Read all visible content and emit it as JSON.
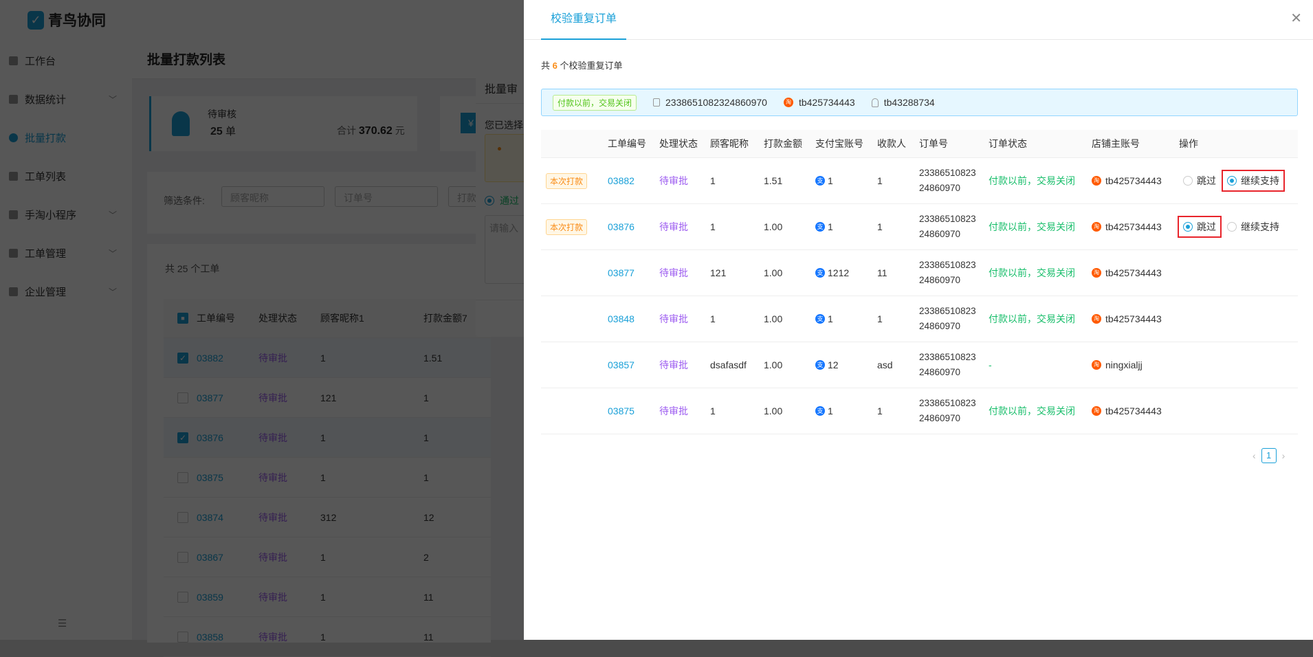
{
  "app": {
    "name": "青鸟协同"
  },
  "sidebar": {
    "items": [
      {
        "label": "工作台",
        "chevron": false
      },
      {
        "label": "数据统计",
        "chevron": true
      },
      {
        "label": "批量打款",
        "chevron": false,
        "active": true
      },
      {
        "label": "工单列表",
        "chevron": false
      },
      {
        "label": "手淘小程序",
        "chevron": true
      },
      {
        "label": "工单管理",
        "chevron": true
      },
      {
        "label": "企业管理",
        "chevron": true
      }
    ],
    "collapse_icon": "☰"
  },
  "page": {
    "title": "批量打款列表",
    "card": {
      "label": "待审核",
      "count": "25",
      "count_unit": "单",
      "total_label": "合计",
      "total": "370.62",
      "total_unit": "元"
    },
    "filter": {
      "label": "筛选条件:",
      "placeholders": [
        "顾客昵称",
        "订单号",
        "打款"
      ]
    },
    "total_text": "共 25 个工单",
    "table": {
      "headers": [
        "工单编号",
        "处理状态",
        "顾客昵称1",
        "打款金额7"
      ],
      "rows": [
        {
          "checked": true,
          "id": "03882",
          "status": "待审批",
          "nick": "1",
          "amount": "1.51"
        },
        {
          "checked": false,
          "id": "03877",
          "status": "待审批",
          "nick": "121",
          "amount": "1"
        },
        {
          "checked": true,
          "id": "03876",
          "status": "待审批",
          "nick": "1",
          "amount": "1"
        },
        {
          "checked": false,
          "id": "03875",
          "status": "待审批",
          "nick": "1",
          "amount": "1"
        },
        {
          "checked": false,
          "id": "03874",
          "status": "待审批",
          "nick": "312",
          "amount": "12"
        },
        {
          "checked": false,
          "id": "03867",
          "status": "待审批",
          "nick": "1",
          "amount": "2"
        },
        {
          "checked": false,
          "id": "03859",
          "status": "待审批",
          "nick": "1",
          "amount": "11"
        },
        {
          "checked": false,
          "id": "03858",
          "status": "待审批",
          "nick": "1",
          "amount": "11"
        }
      ]
    }
  },
  "bg_modal": {
    "title": "批量审",
    "selected_text": "您已选择",
    "radio_label": "通过",
    "textarea_placeholder": "请输入"
  },
  "drawer": {
    "tab": "校验重复订单",
    "close": "✕",
    "count_prefix": "共",
    "count": "6",
    "count_suffix": "个校验重复订单",
    "alert": {
      "status_tag": "付款以前，交易关闭",
      "order_no": "2338651082324860970",
      "shop": "tb425734443",
      "buyer": "tb43288734"
    },
    "headers": [
      "",
      "工单编号",
      "处理状态",
      "顾客昵称",
      "打款金额",
      "支付宝账号",
      "收款人",
      "订单号",
      "订单状态",
      "店铺主账号",
      "操作"
    ],
    "rows": [
      {
        "tag": "本次打款",
        "id": "03882",
        "status": "待审批",
        "nick": "1",
        "amount": "1.51",
        "alipay": "1",
        "payee": "1",
        "order": "2338651082324860970",
        "order_status": "付款以前，交易关闭",
        "shop": "tb425734443",
        "options": [
          "跳过",
          "继续支持"
        ],
        "selected": 1
      },
      {
        "tag": "本次打款",
        "id": "03876",
        "status": "待审批",
        "nick": "1",
        "amount": "1.00",
        "alipay": "1",
        "payee": "1",
        "order": "2338651082324860970",
        "order_status": "付款以前，交易关闭",
        "shop": "tb425734443",
        "options": [
          "跳过",
          "继续支持"
        ],
        "selected": 0
      },
      {
        "tag": "",
        "id": "03877",
        "status": "待审批",
        "nick": "121",
        "amount": "1.00",
        "alipay": "1212",
        "payee": "11",
        "order": "2338651082324860970",
        "order_status": "付款以前，交易关闭",
        "shop": "tb425734443"
      },
      {
        "tag": "",
        "id": "03848",
        "status": "待审批",
        "nick": "1",
        "amount": "1.00",
        "alipay": "1",
        "payee": "1",
        "order": "2338651082324860970",
        "order_status": "付款以前，交易关闭",
        "shop": "tb425734443"
      },
      {
        "tag": "",
        "id": "03857",
        "status": "待审批",
        "nick": "dsafasdf",
        "amount": "1.00",
        "alipay": "12",
        "payee": "asd",
        "order": "2338651082324860970",
        "order_status": "-",
        "shop": "ningxialjj"
      },
      {
        "tag": "",
        "id": "03875",
        "status": "待审批",
        "nick": "1",
        "amount": "1.00",
        "alipay": "1",
        "payee": "1",
        "order": "2338651082324860970",
        "order_status": "付款以前，交易关闭",
        "shop": "tb425734443"
      }
    ],
    "pagination": {
      "current": "1",
      "prev": "‹",
      "next": "›"
    }
  },
  "colors": {
    "accent": "#1aa0d8",
    "pending": "#9c5bf0",
    "closed": "#19be6b",
    "highlight": "#e8242b",
    "tao": "#ff5a00"
  }
}
